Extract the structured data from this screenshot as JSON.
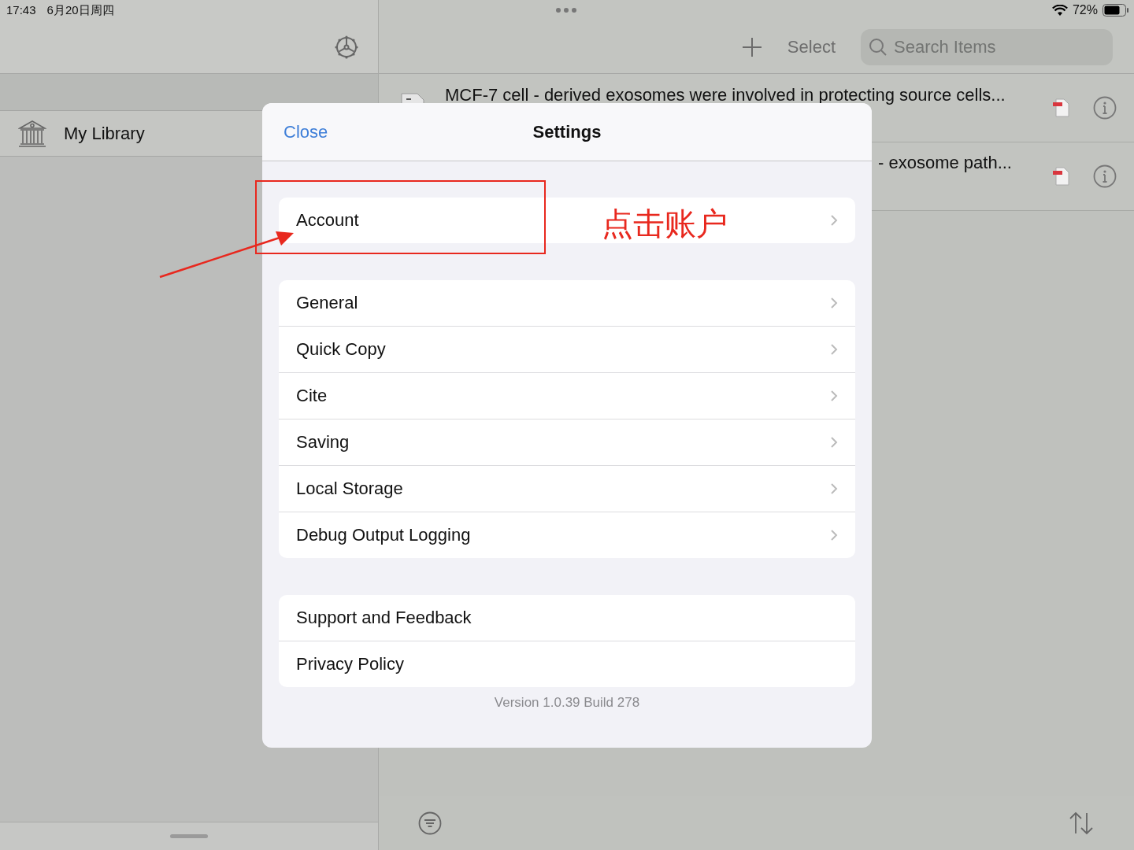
{
  "status_bar": {
    "time": "17:43",
    "date": "6月20日周四",
    "battery": "72%"
  },
  "sidebar": {
    "items": [
      {
        "label": "My Library",
        "selected": false
      }
    ]
  },
  "toolbar": {
    "select": "Select",
    "search": {
      "placeholder": "Search Items"
    }
  },
  "items": [
    {
      "title": "MCF-7 cell - derived exosomes were involved in protecting source cells..."
    },
    {
      "title": "- exosome path..."
    }
  ],
  "settings": {
    "title": "Settings",
    "close": "Close",
    "sections": [
      [
        {
          "label": "Account",
          "disclosure": true
        }
      ],
      [
        {
          "label": "General",
          "disclosure": true
        },
        {
          "label": "Quick Copy",
          "disclosure": true
        },
        {
          "label": "Cite",
          "disclosure": true
        },
        {
          "label": "Saving",
          "disclosure": true
        },
        {
          "label": "Local Storage",
          "disclosure": true
        },
        {
          "label": "Debug Output Logging",
          "disclosure": true
        }
      ],
      [
        {
          "label": "Support and Feedback",
          "disclosure": false
        },
        {
          "label": "Privacy Policy",
          "disclosure": false
        }
      ]
    ],
    "version": "Version 1.0.39 Build 278"
  },
  "annotation": {
    "text": "点击账户"
  }
}
